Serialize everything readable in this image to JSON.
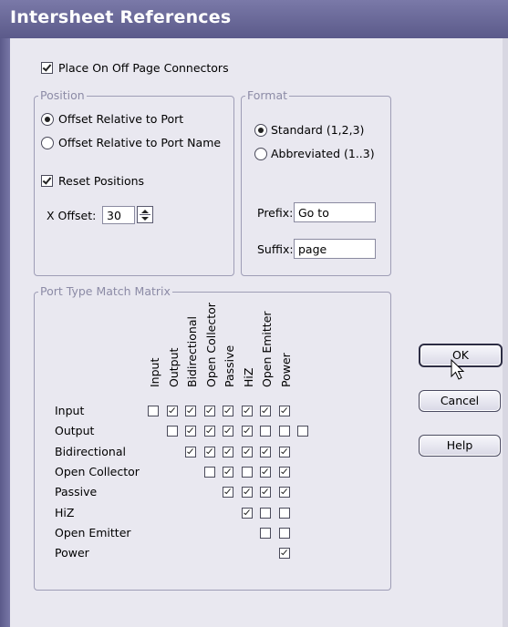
{
  "window": {
    "title": "Intersheet References"
  },
  "place_connectors": {
    "label": "Place On Off Page Connectors",
    "checked": true
  },
  "position": {
    "legend": "Position",
    "options": [
      {
        "label": "Offset Relative to Port",
        "selected": true
      },
      {
        "label": "Offset Relative to Port Name",
        "selected": false
      }
    ],
    "reset_positions": {
      "label": "Reset Positions",
      "checked": true
    },
    "x_offset": {
      "label": "X Offset:",
      "value": "30"
    }
  },
  "format": {
    "legend": "Format",
    "options": [
      {
        "label": "Standard (1,2,3)",
        "selected": true
      },
      {
        "label": "Abbreviated (1..3)",
        "selected": false
      }
    ],
    "prefix": {
      "label": "Prefix:",
      "value": "Go to"
    },
    "suffix": {
      "label": "Suffix:",
      "value": "page"
    }
  },
  "matrix": {
    "legend": "Port Type Match Matrix",
    "columns": [
      "Input",
      "Output",
      "Bidirectional",
      "Open Collector",
      "Passive",
      "HiZ",
      "Open Emitter",
      "Power"
    ],
    "rows": [
      {
        "label": "Input",
        "cells": [
          false,
          true,
          true,
          true,
          true,
          true,
          true,
          true
        ]
      },
      {
        "label": "Output",
        "cells": [
          false,
          true,
          true,
          true,
          true,
          false,
          false,
          false
        ]
      },
      {
        "label": "Bidirectional",
        "cells": [
          true,
          true,
          true,
          true,
          true,
          true
        ]
      },
      {
        "label": "Open Collector",
        "cells": [
          false,
          true,
          false,
          true,
          true
        ]
      },
      {
        "label": "Passive",
        "cells": [
          true,
          true,
          true,
          true
        ]
      },
      {
        "label": "HiZ",
        "cells": [
          true,
          false,
          false
        ]
      },
      {
        "label": "Open Emitter",
        "cells": [
          false,
          false
        ]
      },
      {
        "label": "Power",
        "cells": [
          true
        ]
      }
    ]
  },
  "buttons": {
    "ok": "OK",
    "cancel": "Cancel",
    "help": "Help"
  }
}
